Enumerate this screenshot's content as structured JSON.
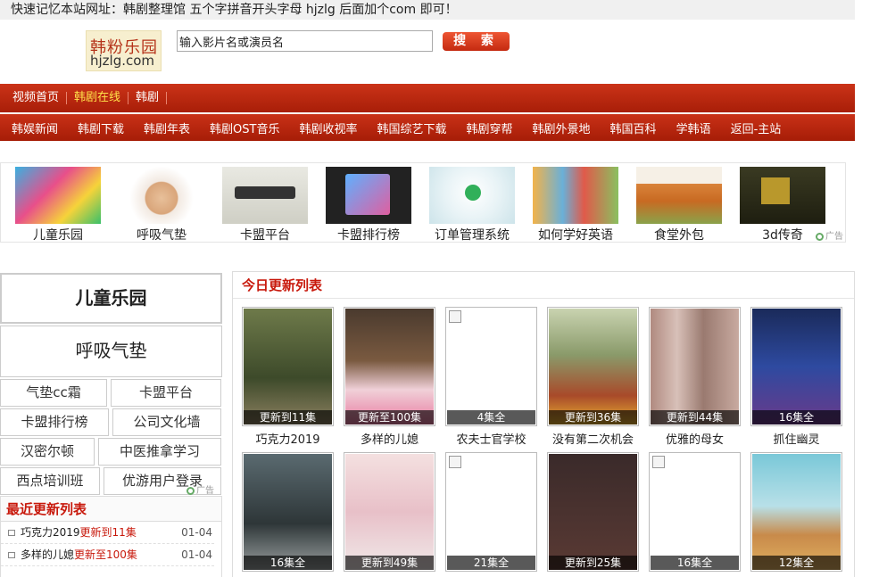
{
  "top_notice": "快速记忆本站网址：韩剧整理馆 五个字拼音开头字母 hjzlg 后面加个com 即可！",
  "logo": {
    "line1": "韩粉乐园",
    "line2": "hjzlg.com"
  },
  "search": {
    "value": "输入影片名或演员名",
    "button": "搜 索"
  },
  "nav_primary": [
    "视频首页",
    "韩剧在线",
    "韩剧"
  ],
  "nav_secondary": [
    "韩娱新闻",
    "韩剧下载",
    "韩剧年表",
    "韩剧OST音乐",
    "韩剧收视率",
    "韩国综艺下载",
    "韩剧穿帮",
    "韩剧外景地",
    "韩国百科",
    "学韩语",
    "返回-主站"
  ],
  "ads": [
    "儿童乐园",
    "呼吸气垫",
    "卡盟平台",
    "卡盟排行榜",
    "订单管理系统",
    "如何学好英语",
    "食堂外包",
    "3d传奇"
  ],
  "ad_tag": "广告",
  "left_links": {
    "big": [
      "儿童乐园",
      "呼吸气垫"
    ],
    "small": [
      "气垫cc霜",
      "卡盟平台",
      "卡盟排行榜",
      "公司文化墙",
      "汉密尔顿",
      "中医推拿学习",
      "西点培训班",
      "优游用户登录"
    ]
  },
  "recent": {
    "title": "最近更新列表",
    "items": [
      {
        "name": "巧克力2019",
        "update": "更新到11集",
        "date": "01-04"
      },
      {
        "name": "多样的儿媳",
        "update": "更新至100集",
        "date": "01-04"
      }
    ]
  },
  "today": {
    "title": "今日更新列表",
    "row1": [
      {
        "status": "更新到11集",
        "title": "巧克力2019"
      },
      {
        "status": "更新至100集",
        "title": "多样的儿媳"
      },
      {
        "status": "4集全",
        "title": "农夫士官学校"
      },
      {
        "status": "更新到36集",
        "title": "没有第二次机会"
      },
      {
        "status": "更新到44集",
        "title": "优雅的母女"
      },
      {
        "status": "16集全",
        "title": "抓住幽灵"
      }
    ],
    "row2": [
      {
        "status": "16集全"
      },
      {
        "status": "更新到49集"
      },
      {
        "status": "21集全"
      },
      {
        "status": "更新到25集"
      },
      {
        "status": "16集全"
      },
      {
        "status": "12集全"
      }
    ]
  }
}
